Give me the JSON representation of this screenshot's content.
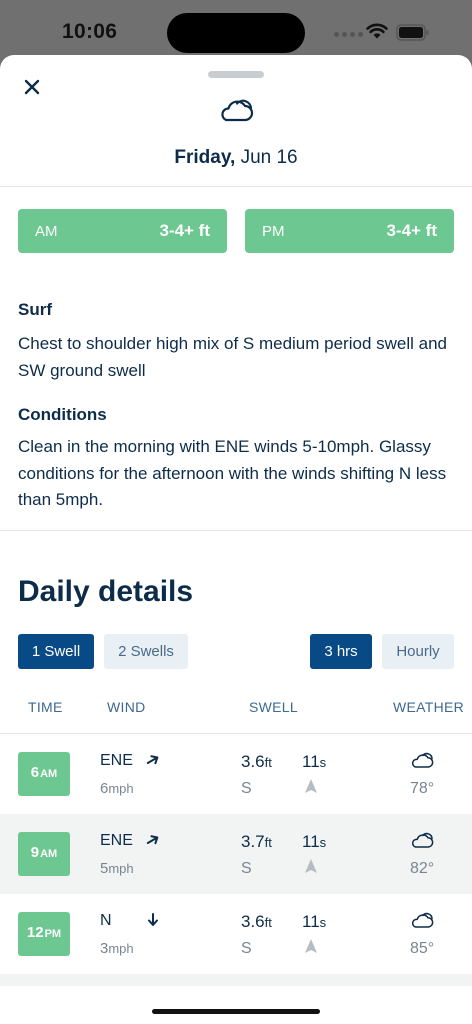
{
  "status_bar": {
    "time": "10:06"
  },
  "header": {
    "day": "Friday,",
    "date": "Jun 16",
    "icon": "cloud-icon"
  },
  "ratings": [
    {
      "label": "AM",
      "value": "3-4+ ft"
    },
    {
      "label": "PM",
      "value": "3-4+ ft"
    }
  ],
  "surf": {
    "title": "Surf",
    "text": "Chest to shoulder high mix of S medium period swell and SW ground swell"
  },
  "conditions": {
    "title": "Conditions",
    "text": "Clean in the morning with ENE winds 5-10mph. Glassy conditions for the afternoon with the winds shifting N less than 5mph."
  },
  "daily": {
    "title": "Daily details",
    "swell_toggle": [
      "1 Swell",
      "2 Swells"
    ],
    "interval_toggle": [
      "3 hrs",
      "Hourly"
    ],
    "columns": [
      "TIME",
      "WIND",
      "SWELL",
      "WEATHER"
    ],
    "rows": [
      {
        "hour": "6",
        "ampm": "AM",
        "wind_dir": "ENE",
        "wind_speed": "6",
        "wind_unit": "mph",
        "swell_height": "3.6",
        "height_unit": "ft",
        "swell_period": "11",
        "period_unit": "s",
        "swell_dir": "S",
        "temp": "78°"
      },
      {
        "hour": "9",
        "ampm": "AM",
        "wind_dir": "ENE",
        "wind_speed": "5",
        "wind_unit": "mph",
        "swell_height": "3.7",
        "height_unit": "ft",
        "swell_period": "11",
        "period_unit": "s",
        "swell_dir": "S",
        "temp": "82°"
      },
      {
        "hour": "12",
        "ampm": "PM",
        "wind_dir": "N",
        "wind_speed": "3",
        "wind_unit": "mph",
        "swell_height": "3.6",
        "height_unit": "ft",
        "swell_period": "11",
        "period_unit": "s",
        "swell_dir": "S",
        "temp": "85°"
      }
    ]
  },
  "colors": {
    "accent_green": "#6cc791",
    "navy": "#0d2c4a",
    "active_blue": "#084a85"
  }
}
